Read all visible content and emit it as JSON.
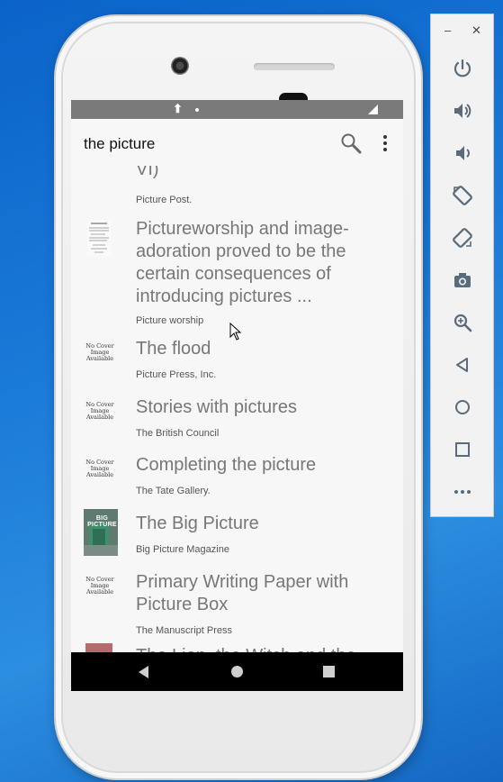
{
  "toolbar": {
    "title": "the picture"
  },
  "status": {
    "upload_glyph": "⬆"
  },
  "results": [
    {
      "title": "VI)",
      "subtitle": "Picture Post.",
      "thumb": "none"
    },
    {
      "title": "Pictureworship and image-adoration proved to be the certain consequences of introducing pictures ...",
      "subtitle": "Picture worship",
      "thumb": "text-page"
    },
    {
      "title": "The flood",
      "subtitle": "Picture Press, Inc.",
      "thumb": "no-cover"
    },
    {
      "title": "Stories with pictures",
      "subtitle": "The British Council",
      "thumb": "no-cover"
    },
    {
      "title": "Completing the picture",
      "subtitle": "The Tate Gallery.",
      "thumb": "no-cover"
    },
    {
      "title": "The Big Picture",
      "subtitle": "Big Picture Magazine",
      "thumb": "magazine-cover"
    },
    {
      "title": "Primary Writing Paper with Picture Box",
      "subtitle": "The Manuscript Press",
      "thumb": "no-cover"
    },
    {
      "title": "The Lion, the Witch and the",
      "subtitle": "",
      "thumb": "book-cover"
    }
  ],
  "no_cover_text": "No Cover Image Available",
  "big_picture_cover_text": "BIG PICTURE",
  "emulator_toolbar": {
    "window_controls": {
      "minimize": "–",
      "close": "✕"
    },
    "buttons": [
      "power-icon",
      "volume-up-icon",
      "volume-down-icon",
      "rotate-left-icon",
      "rotate-right-icon",
      "camera-icon",
      "zoom-icon",
      "back-icon",
      "home-icon",
      "overview-icon",
      "more-icon"
    ]
  },
  "colors": {
    "desktop": "#1a7ad8",
    "status_bar": "#7a7a7a",
    "title_text": "#777777",
    "nav_bar": "#000000",
    "emulator_icon": "#5a6b7b"
  }
}
